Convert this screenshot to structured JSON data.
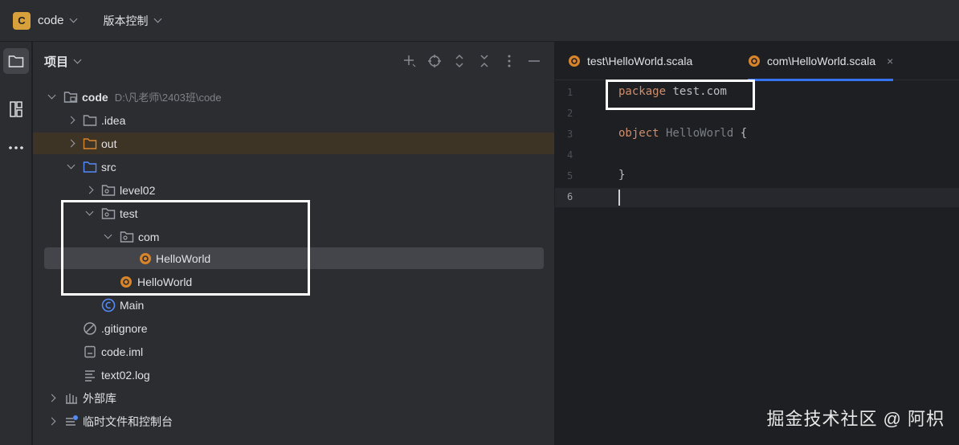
{
  "topbar": {
    "project_badge": "C",
    "project_name": "code",
    "vcs_label": "版本控制"
  },
  "panel": {
    "title": "项目"
  },
  "tree": [
    {
      "label": "code",
      "path": "D:\\凡老师\\2403班\\code",
      "icon": "module-folder-icon",
      "expanded": true
    },
    {
      "label": ".idea",
      "icon": "folder-icon",
      "expanded": false
    },
    {
      "label": "out",
      "icon": "folder-orange-icon",
      "expanded": false
    },
    {
      "label": "src",
      "icon": "source-folder-icon",
      "expanded": true
    },
    {
      "label": "level02",
      "icon": "package-icon",
      "expanded": false
    },
    {
      "label": "test",
      "icon": "package-icon",
      "expanded": true
    },
    {
      "label": "com",
      "icon": "package-icon",
      "expanded": true
    },
    {
      "label": "HelloWorld",
      "icon": "scala-object-icon"
    },
    {
      "label": "HelloWorld",
      "icon": "scala-object-icon"
    },
    {
      "label": "Main",
      "icon": "java-class-icon"
    },
    {
      "label": ".gitignore",
      "icon": "ignore-file-icon"
    },
    {
      "label": "code.iml",
      "icon": "iml-file-icon"
    },
    {
      "label": "text02.log",
      "icon": "text-file-icon"
    },
    {
      "label": "外部库",
      "icon": "library-icon",
      "expanded": false
    },
    {
      "label": "临时文件和控制台",
      "icon": "scratch-icon",
      "expanded": false
    }
  ],
  "editor": {
    "tabs": [
      {
        "label": "test\\HelloWorld.scala",
        "active": false
      },
      {
        "label": "com\\HelloWorld.scala",
        "active": true,
        "close": "×"
      }
    ],
    "line_numbers": [
      "1",
      "2",
      "3",
      "4",
      "5",
      "6"
    ],
    "lines": {
      "l1_kw": "package",
      "l1_rest": " test.com",
      "l3_kw": "object",
      "l3_name": " HelloWorld",
      "l3_rest": " {",
      "l5": "}"
    }
  },
  "watermark": "掘金技术社区 @ 阿枳",
  "colors": {
    "accent": "#3574f0",
    "scala": "#d8842b",
    "keyword": "#cf8e6d",
    "folder": "#9da0a8"
  }
}
